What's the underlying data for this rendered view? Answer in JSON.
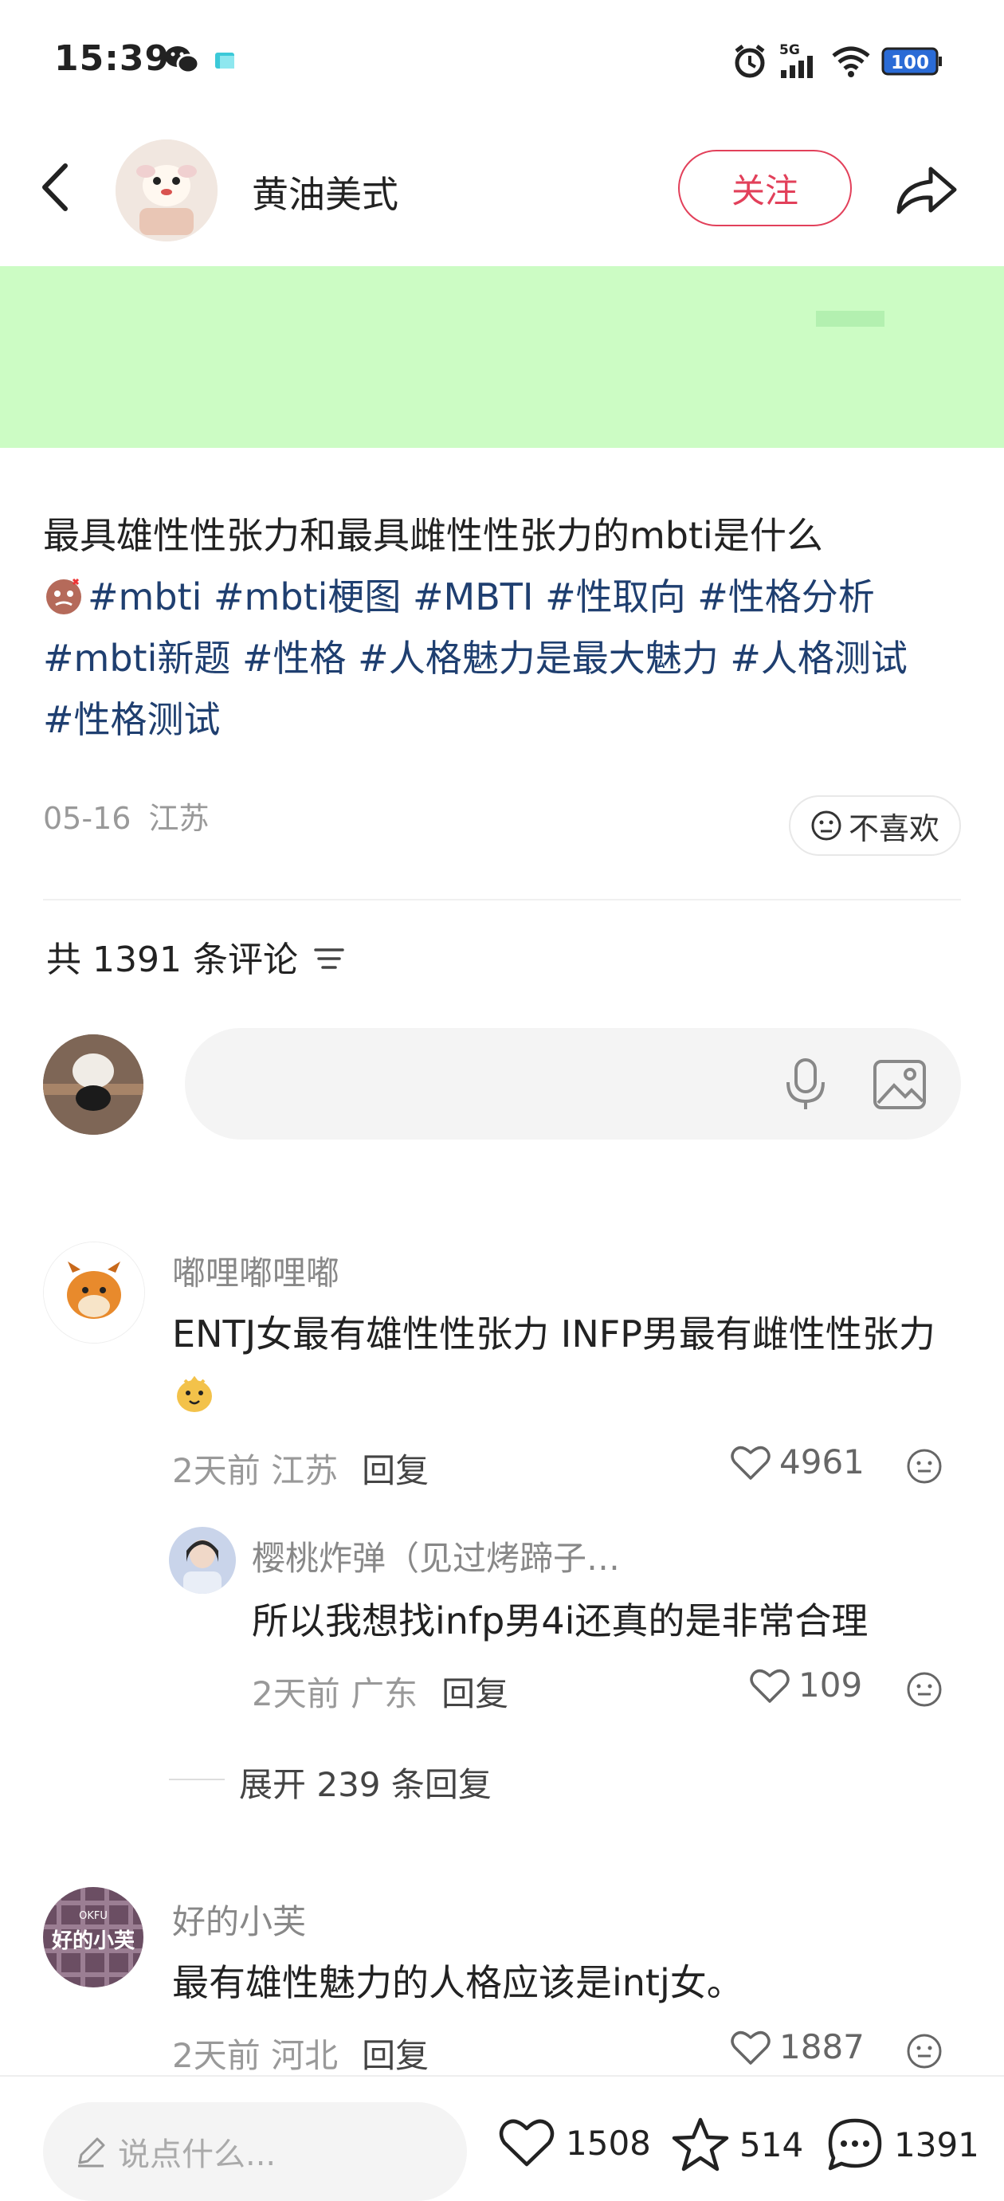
{
  "status_bar": {
    "time": "15:39",
    "network": "5G",
    "battery": "100"
  },
  "header": {
    "author_name": "黄油美式",
    "follow_label": "关注"
  },
  "post": {
    "title": "最具雄性性张力和最具雌性性张力的mbti是什么",
    "tags": [
      "#mbti",
      "#mbti梗图",
      "#MBTI",
      "#性取向",
      "#性格分析",
      "#mbti新题",
      "#性格",
      "#人格魅力是最大魅力",
      "#人格测试",
      "#性格测试"
    ],
    "date": "05-16",
    "location": "江苏",
    "dislike_label": "不喜欢"
  },
  "comments_section": {
    "count_label": "共 1391 条评论"
  },
  "comments": [
    {
      "user": "嘟哩嘟哩嘟",
      "text": "ENTJ女最有雄性性张力 INFP男最有雌性性张力",
      "time": "2天前",
      "location": "江苏",
      "reply_label": "回复",
      "likes": "4961"
    },
    {
      "user": "樱桃炸弹（见过烤蹄子…",
      "text": "所以我想找infp男4i还真的是非常合理",
      "time": "2天前",
      "location": "广东",
      "reply_label": "回复",
      "likes": "109"
    },
    {
      "user": "好的小芙",
      "text": "最有雄性魅力的人格应该是intj女。",
      "time": "2天前",
      "location": "河北",
      "reply_label": "回复",
      "likes": "1887"
    }
  ],
  "expand_replies": "展开 239 条回复",
  "avatar_texts": {
    "c3_small": "OKFU",
    "c3_main": "好的小芙"
  },
  "bottom_bar": {
    "placeholder": "说点什么...",
    "likes": "1508",
    "stars": "514",
    "comments": "1391"
  }
}
